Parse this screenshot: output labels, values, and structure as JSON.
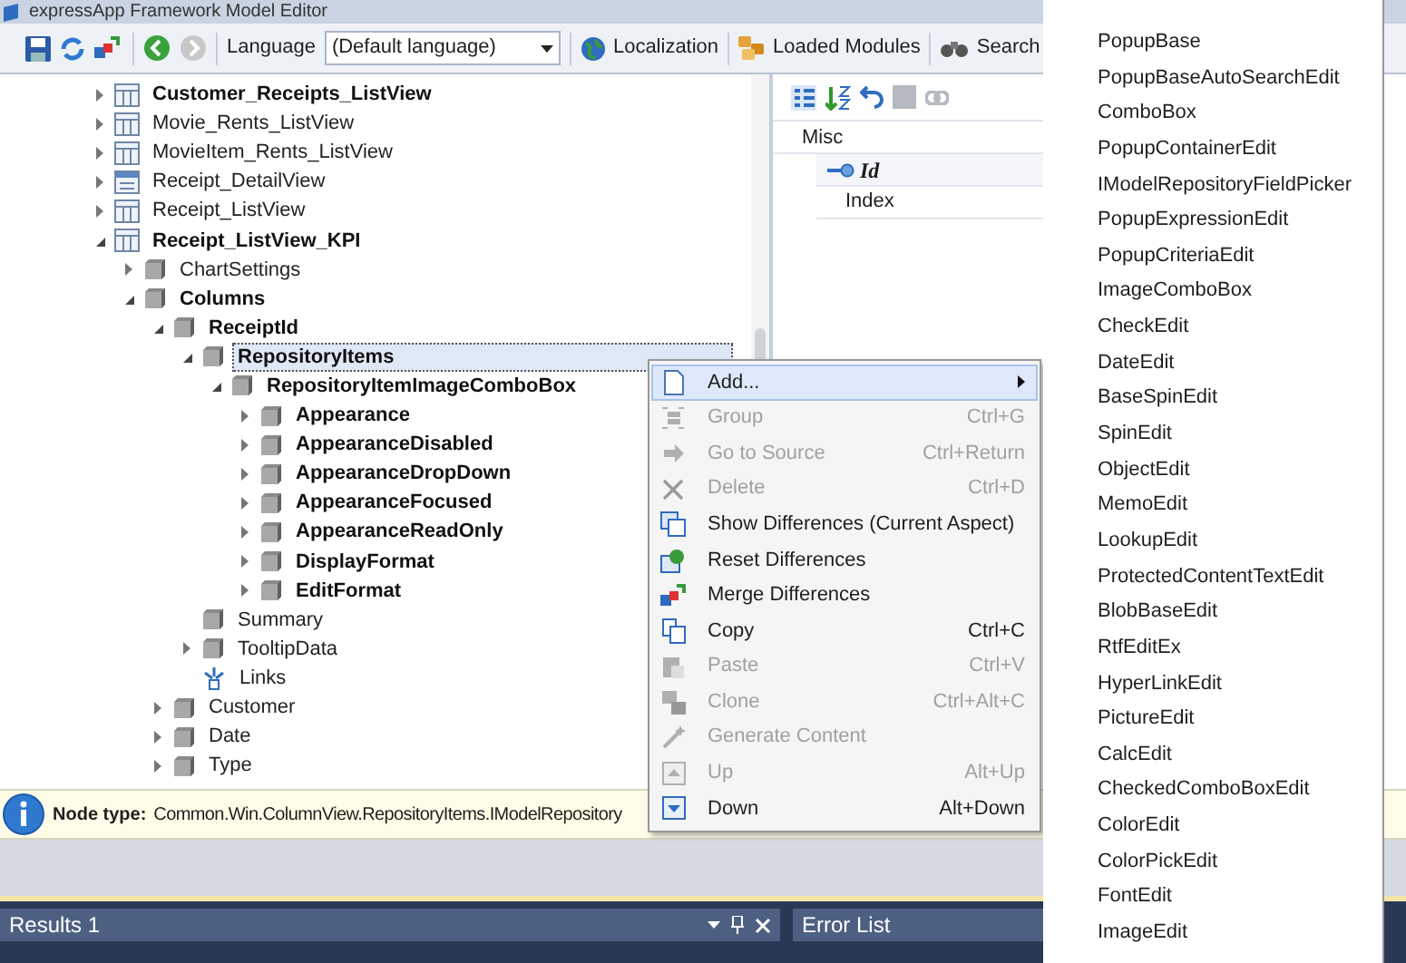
{
  "window": {
    "title": "expressApp Framework Model Editor"
  },
  "toolbar": {
    "language_label": "Language",
    "language": "(Default language)",
    "buttons": [
      {
        "kind": "globe",
        "label": "Localization"
      },
      {
        "kind": "modules",
        "label": "Loaded Modules"
      },
      {
        "kind": "search",
        "label": "Search"
      }
    ]
  },
  "tree": [
    {
      "label": "Customer_Receipts_ListView",
      "kind": "listview",
      "modified": true,
      "expanded": false,
      "selected": false
    },
    {
      "label": "Movie_Rents_ListView",
      "kind": "listview",
      "modified": false,
      "expanded": false,
      "selected": false
    },
    {
      "label": "MovieItem_Rents_ListView",
      "kind": "listview",
      "modified": false,
      "expanded": false,
      "selected": false
    },
    {
      "label": "Receipt_DetailView",
      "kind": "detailview",
      "modified": false,
      "expanded": false,
      "selected": false
    },
    {
      "label": "Receipt_ListView",
      "kind": "listview",
      "modified": false,
      "expanded": false,
      "selected": false
    },
    {
      "label": "Receipt_ListView_KPI",
      "kind": "listview",
      "modified": true,
      "expanded": true,
      "selected": false,
      "children": [
        {
          "label": "ChartSettings",
          "kind": "node",
          "modified": false,
          "expanded": false,
          "selected": false
        },
        {
          "label": "Columns",
          "kind": "node",
          "modified": true,
          "expanded": true,
          "selected": false,
          "children": [
            {
              "label": "ReceiptId",
              "kind": "node",
              "modified": true,
              "expanded": true,
              "selected": false,
              "children": [
                {
                  "label": "RepositoryItems",
                  "kind": "node",
                  "modified": true,
                  "expanded": true,
                  "selected": true,
                  "children": [
                    {
                      "label": "RepositoryItemImageComboBox",
                      "kind": "node",
                      "modified": true,
                      "expanded": true,
                      "selected": false,
                      "children": [
                        {
                          "label": "Appearance",
                          "kind": "node",
                          "modified": true,
                          "expanded": false,
                          "selected": false
                        },
                        {
                          "label": "AppearanceDisabled",
                          "kind": "node",
                          "modified": true,
                          "expanded": false,
                          "selected": false
                        },
                        {
                          "label": "AppearanceDropDown",
                          "kind": "node",
                          "modified": true,
                          "expanded": false,
                          "selected": false
                        },
                        {
                          "label": "AppearanceFocused",
                          "kind": "node",
                          "modified": true,
                          "expanded": false,
                          "selected": false
                        },
                        {
                          "label": "AppearanceReadOnly",
                          "kind": "node",
                          "modified": true,
                          "expanded": false,
                          "selected": false
                        },
                        {
                          "label": "DisplayFormat",
                          "kind": "node",
                          "modified": true,
                          "expanded": false,
                          "selected": false
                        },
                        {
                          "label": "EditFormat",
                          "kind": "node",
                          "modified": true,
                          "expanded": false,
                          "selected": false
                        }
                      ]
                    }
                  ]
                },
                {
                  "label": "Summary",
                  "kind": "node",
                  "modified": false,
                  "selected": false
                },
                {
                  "label": "TooltipData",
                  "kind": "node",
                  "modified": false,
                  "expanded": false,
                  "selected": false
                },
                {
                  "label": "Links",
                  "kind": "links",
                  "modified": false,
                  "selected": false
                }
              ]
            },
            {
              "label": "Customer",
              "kind": "node",
              "modified": false,
              "expanded": false,
              "selected": false
            },
            {
              "label": "Date",
              "kind": "node",
              "modified": false,
              "expanded": false,
              "selected": false
            },
            {
              "label": "Type",
              "kind": "node",
              "modified": false,
              "expanded": false,
              "selected": false
            }
          ]
        }
      ]
    }
  ],
  "properties": {
    "category": "Misc",
    "rows": [
      {
        "label": "Id",
        "kind": "key"
      },
      {
        "label": "Index",
        "kind": "plain"
      }
    ]
  },
  "info_bar": {
    "label": "Node type:",
    "value": "Common.Win.ColumnView.RepositoryItems.IModelRepository"
  },
  "panels": [
    {
      "title": "Results 1",
      "kind": "docked"
    },
    {
      "title": "Error List",
      "kind": "tab"
    }
  ],
  "context_menu": [
    {
      "label": "Add...",
      "kind": "add",
      "disabled": false,
      "selected": true,
      "submenu": true
    },
    {
      "label": "Group",
      "shortcut": "Ctrl+G",
      "kind": "group",
      "disabled": true,
      "selected": false,
      "submenu": false
    },
    {
      "label": "Go to Source",
      "shortcut": "Ctrl+Return",
      "kind": "goto",
      "disabled": true,
      "selected": false,
      "submenu": false
    },
    {
      "label": "Delete",
      "shortcut": "Ctrl+D",
      "kind": "delete",
      "disabled": true,
      "selected": false,
      "submenu": false
    },
    {
      "label": "Show Differences (Current Aspect)",
      "kind": "diff",
      "disabled": false,
      "selected": false,
      "submenu": false
    },
    {
      "label": "Reset Differences",
      "kind": "reset",
      "disabled": false,
      "selected": false,
      "submenu": false
    },
    {
      "label": "Merge Differences",
      "kind": "merge",
      "disabled": false,
      "selected": false,
      "submenu": false
    },
    {
      "label": "Copy",
      "shortcut": "Ctrl+C",
      "kind": "copy",
      "disabled": false,
      "selected": false,
      "submenu": false
    },
    {
      "label": "Paste",
      "shortcut": "Ctrl+V",
      "kind": "paste",
      "disabled": true,
      "selected": false,
      "submenu": false
    },
    {
      "label": "Clone",
      "shortcut": "Ctrl+Alt+C",
      "kind": "clone",
      "disabled": true,
      "selected": false,
      "submenu": false
    },
    {
      "label": "Generate Content",
      "kind": "generate",
      "disabled": true,
      "selected": false,
      "submenu": false
    },
    {
      "label": "Up",
      "shortcut": "Alt+Up",
      "kind": "up",
      "disabled": true,
      "selected": false,
      "submenu": false
    },
    {
      "label": "Down",
      "shortcut": "Alt+Down",
      "kind": "down",
      "disabled": false,
      "selected": false,
      "submenu": false
    }
  ],
  "submenu": [
    "PopupBase",
    "PopupBaseAutoSearchEdit",
    "ComboBox",
    "PopupContainerEdit",
    "IModelRepositoryFieldPicker",
    "PopupExpressionEdit",
    "PopupCriteriaEdit",
    "ImageComboBox",
    "CheckEdit",
    "DateEdit",
    "BaseSpinEdit",
    "SpinEdit",
    "ObjectEdit",
    "MemoEdit",
    "LookupEdit",
    "ProtectedContentTextEdit",
    "BlobBaseEdit",
    "RtfEditEx",
    "HyperLinkEdit",
    "PictureEdit",
    "CalcEdit",
    "CheckedComboBoxEdit",
    "ColorEdit",
    "ColorPickEdit",
    "FontEdit",
    "ImageEdit"
  ]
}
